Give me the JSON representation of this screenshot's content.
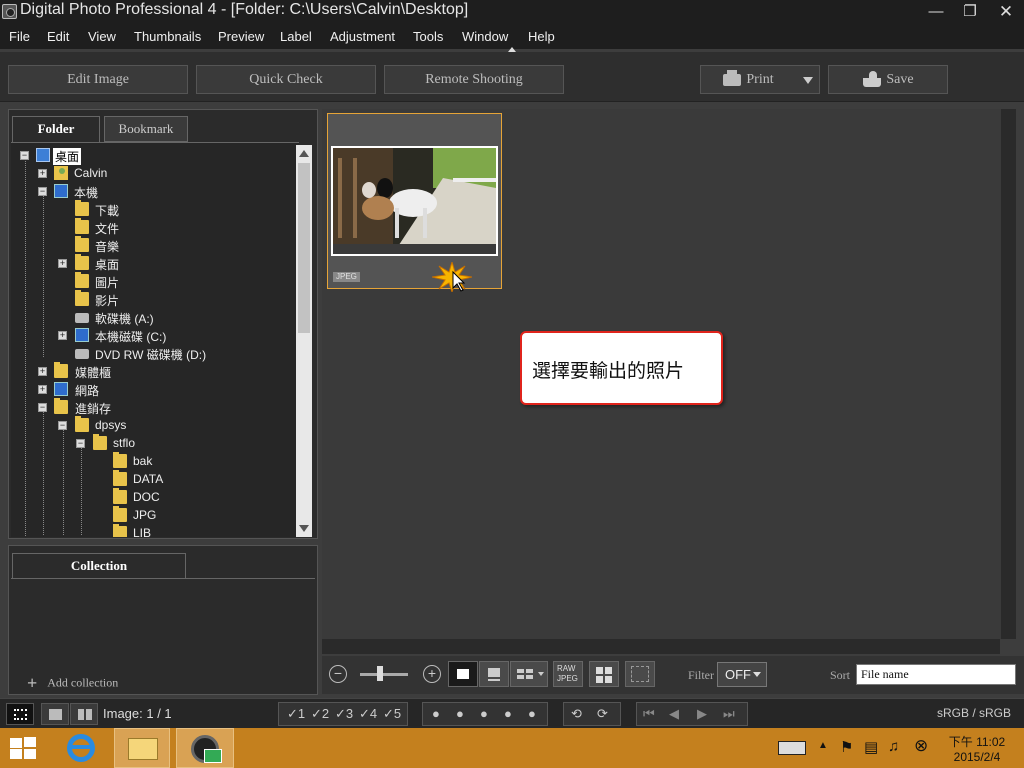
{
  "window": {
    "title": "Digital Photo Professional 4 - [Folder: C:\\Users\\Calvin\\Desktop]"
  },
  "menu": [
    "File",
    "Edit",
    "View",
    "Thumbnails",
    "Preview",
    "Label",
    "Adjustment",
    "Tools",
    "Window",
    "Help"
  ],
  "toolbar": {
    "edit_image": "Edit Image",
    "quick_check": "Quick Check",
    "remote_shooting": "Remote Shooting",
    "print": "Print",
    "save": "Save"
  },
  "left_tabs": {
    "folder": "Folder",
    "bookmark": "Bookmark"
  },
  "tree": [
    "桌面",
    "Calvin",
    "本機",
    "下載",
    "文件",
    "音樂",
    "桌面",
    "圖片",
    "影片",
    "軟碟機 (A:)",
    "本機磁碟 (C:)",
    "DVD RW 磁碟機 (D:)",
    "媒體櫃",
    "網路",
    "進銷存",
    "dpsys",
    "stflo",
    "bak",
    "DATA",
    "DOC",
    "JPG",
    "LIB"
  ],
  "collection": {
    "tab": "Collection",
    "add": "Add collection"
  },
  "thumbnail": {
    "badge": "JPEG"
  },
  "callout": "選擇要輸出的照片",
  "controls": {
    "raw_jpeg_top": "RAW",
    "raw_jpeg_bottom": "JPEG",
    "filter_label": "Filter",
    "filter_value": "OFF",
    "sort_label": "Sort",
    "sort_value": "File name"
  },
  "status": {
    "image_count": "Image: 1 / 1",
    "ratings": [
      "1",
      "2",
      "3",
      "4",
      "5"
    ],
    "color_space": "sRGB / sRGB"
  },
  "taskbar": {
    "time": "下午 11:02",
    "date": "2015/2/4"
  },
  "icons": [
    "app-icon",
    "minimize-icon",
    "maximize-icon",
    "close-icon",
    "printer-icon",
    "save-icon",
    "folder-icon",
    "desktop-icon",
    "computer-icon",
    "drive-icon",
    "zoom-out-icon",
    "zoom-in-icon",
    "windows-logo-icon",
    "ie-icon",
    "explorer-icon",
    "dpp-icon",
    "keyboard-icon",
    "flag-icon",
    "network-icon",
    "volume-icon"
  ]
}
